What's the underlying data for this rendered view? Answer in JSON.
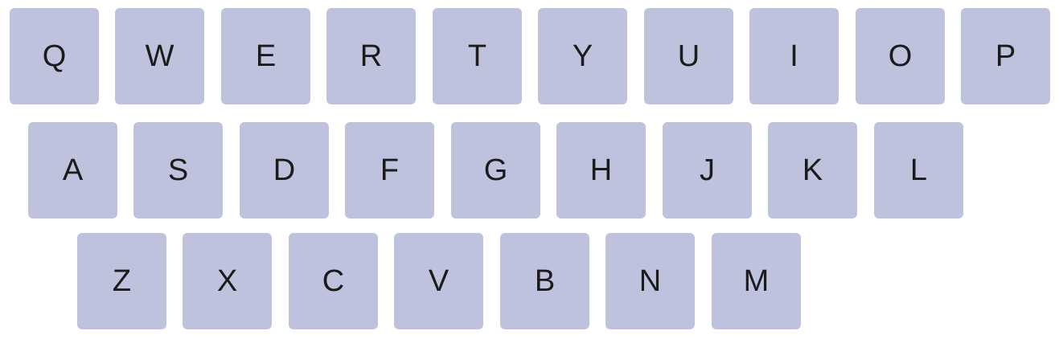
{
  "keyboard": {
    "colors": {
      "key_background": "#bfc2dc",
      "key_text": "#1b1b1b",
      "page_background": "#ffffff"
    },
    "rows": [
      [
        "Q",
        "W",
        "E",
        "R",
        "T",
        "Y",
        "U",
        "I",
        "O",
        "P"
      ],
      [
        "A",
        "S",
        "D",
        "F",
        "G",
        "H",
        "J",
        "K",
        "L"
      ],
      [
        "Z",
        "X",
        "C",
        "V",
        "B",
        "N",
        "M"
      ]
    ]
  }
}
